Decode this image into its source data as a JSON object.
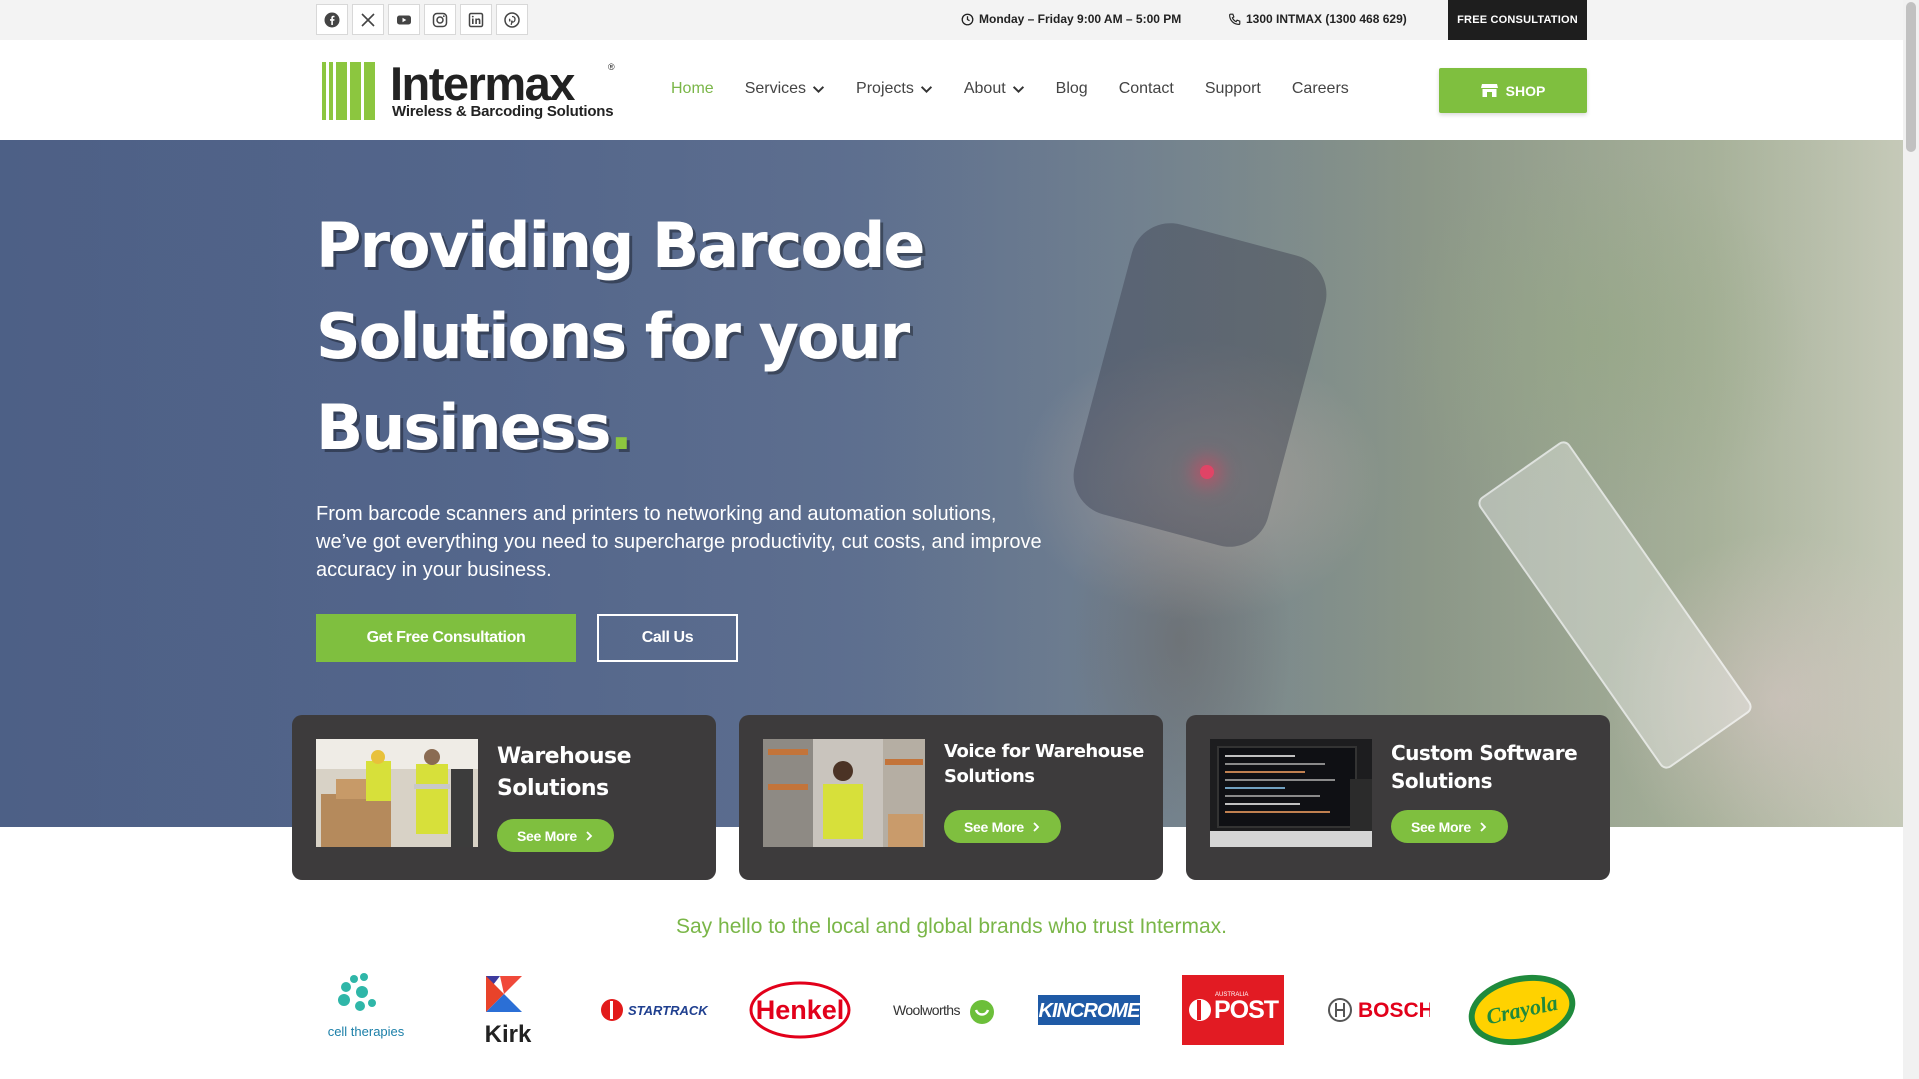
{
  "topbar": {
    "socials": [
      "facebook-icon",
      "x-icon",
      "youtube-icon",
      "instagram-icon",
      "linkedin-icon",
      "pinterest-icon"
    ],
    "hours": "Monday – Friday 9:00 AM – 5:00 PM",
    "phone": "1300 INTMAX (1300 468 629)",
    "cta": "FREE CONSULTATION"
  },
  "header": {
    "logo_name": "Intermax",
    "logo_tagline": "Wireless & Barcoding Solutions",
    "logo_reg": "®",
    "nav": [
      {
        "label": "Home",
        "active": true
      },
      {
        "label": "Services",
        "dropdown": true
      },
      {
        "label": "Projects",
        "dropdown": true
      },
      {
        "label": "About",
        "dropdown": true
      },
      {
        "label": "Blog"
      },
      {
        "label": "Contact"
      },
      {
        "label": "Support"
      },
      {
        "label": "Careers"
      }
    ],
    "shop_label": "SHOP"
  },
  "hero": {
    "title_line1": "Providing Barcode",
    "title_line2": "Solutions for your",
    "title_line3": "Business",
    "title_dot": ".",
    "subtitle": "From barcode scanners and printers to networking and automation solutions, we’ve got everything you need to supercharge productivity, cut costs, and improve accuracy in your business.",
    "primary_btn": "Get Free Consultation",
    "secondary_btn": "Call Us"
  },
  "cards": [
    {
      "title_line1": "Warehouse",
      "title_line2": "Solutions",
      "button": "See More"
    },
    {
      "title_line1": "Voice for Warehouse",
      "title_line2": "Solutions",
      "button": "See More"
    },
    {
      "title_line1": "Custom Software",
      "title_line2": "Solutions",
      "button": "See More"
    }
  ],
  "brands": {
    "heading": "Say hello to the local and global brands who trust Intermax.",
    "logos": {
      "cell_therapies": "cell therapies",
      "kirk": "Kirk",
      "startrack": "STARTRACK",
      "henkel": "Henkel",
      "woolworths": "Woolworths",
      "kincrome": "KINCROME",
      "auspost_small": "AUSTRALIA",
      "auspost": "POST",
      "bosch": "BOSCH",
      "crayola": "Crayola"
    }
  },
  "colors": {
    "accent_green": "#7fbf3f",
    "dark_card": "#3d3b3c",
    "topbar_cta": "#1e1e1e"
  }
}
